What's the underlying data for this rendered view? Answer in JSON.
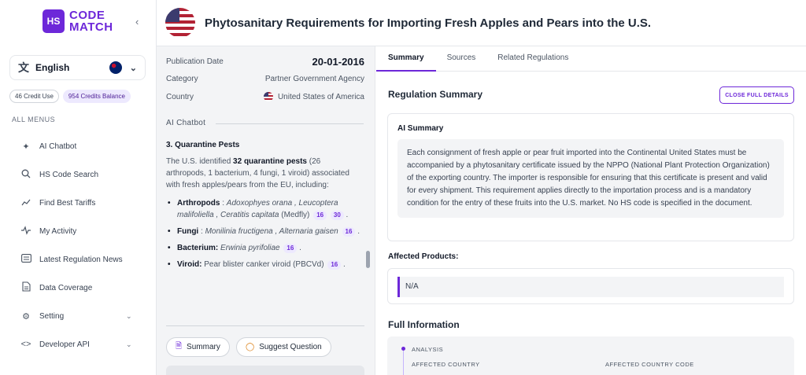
{
  "sidebar": {
    "logo": {
      "mark": "HS",
      "line1": "CODE",
      "line2": "MATCH"
    },
    "collapse_icon": "chevron-left-icon",
    "language": {
      "label": "English",
      "icon": "translate-icon"
    },
    "credits": {
      "used": "46 Credit Use",
      "balance": "954 Credits Balance"
    },
    "menu_title": "ALL MENUS",
    "items": [
      {
        "label": "AI Chatbot",
        "icon": "sparkle-icon",
        "has_chevron": false
      },
      {
        "label": "HS Code Search",
        "icon": "search-icon",
        "has_chevron": false
      },
      {
        "label": "Find Best Tariffs",
        "icon": "trend-icon",
        "has_chevron": false
      },
      {
        "label": "My Activity",
        "icon": "activity-icon",
        "has_chevron": false
      },
      {
        "label": "Latest Regulation News",
        "icon": "news-icon",
        "has_chevron": false
      },
      {
        "label": "Data Coverage",
        "icon": "document-icon",
        "has_chevron": false
      },
      {
        "label": "Setting",
        "icon": "gear-icon",
        "has_chevron": true
      },
      {
        "label": "Developer API",
        "icon": "code-icon",
        "has_chevron": true
      }
    ]
  },
  "header": {
    "title": "Phytosanitary Requirements for Importing Fresh Apples and Pears into the U.S."
  },
  "meta": {
    "publication_date_label": "Publication Date",
    "publication_date": "20-01-2016",
    "category_label": "Category",
    "category": "Partner Government Agency",
    "country_label": "Country",
    "country": "United States of America"
  },
  "chatbot": {
    "label": "AI Chatbot",
    "heading": "3. Quarantine Pests",
    "intro_pre": "The U.S. identified ",
    "intro_bold": "32 quarantine pests",
    "intro_post": " (26 arthropods, 1 bacterium, 4 fungi, 1 viroid) associated with fresh apples/pears from the EU, including:",
    "pests": {
      "arthropods": {
        "name": "Arthropods",
        "sep": " : ",
        "species": "Adoxophyes orana , Leucoptera malifoliella , Ceratitis capitata",
        "extra": " (Medfly)",
        "refs": [
          "16",
          "30"
        ]
      },
      "fungi": {
        "name": "Fungi",
        "sep": " : ",
        "species": "Monilinia fructigena , Alternaria gaisen",
        "refs": [
          "16"
        ]
      },
      "bacterium": {
        "name": "Bacterium:",
        "species": "Erwinia pyrifoliae",
        "refs": [
          "16"
        ]
      },
      "viroid": {
        "name": "Viroid:",
        "species": "Pear blister canker viroid (PBCVd)",
        "refs": [
          "16"
        ]
      }
    },
    "summary_button": "Summary",
    "suggest_button": "Suggest Question"
  },
  "tabs": [
    "Summary",
    "Sources",
    "Related Regulations"
  ],
  "summary": {
    "title": "Regulation Summary",
    "close_button": "CLOSE FULL DETAILS",
    "ai_title": "AI Summary",
    "ai_text": "Each consignment of fresh apple or pear fruit imported into the Continental United States must be accompanied by a phytosanitary certificate issued by the NPPO (National Plant Protection Organization) of the exporting country. The importer is responsible for ensuring that this certificate is present and valid for every shipment. This requirement applies directly to the importation process and is a mandatory condition for the entry of these fruits into the U.S. market. No HS code is specified in the document.",
    "affected_products_title": "Affected Products:",
    "affected_products_value": "N/A",
    "full_info_title": "Full Information",
    "analysis_label": "ANALYSIS",
    "col_country": "AFFECTED COUNTRY",
    "col_country_code": "AFFECTED COUNTRY CODE"
  },
  "colors": {
    "accent": "#6d28d9",
    "accent_light": "#ede9fe",
    "panel_bg": "#f3f4f6"
  }
}
